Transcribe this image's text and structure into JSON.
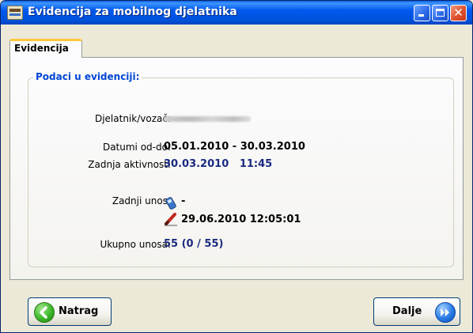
{
  "window": {
    "title": "Evidencija za mobilnog djelatnika"
  },
  "tab": {
    "label": "Evidencija"
  },
  "group": {
    "legend": "Podaci u evidenciji:"
  },
  "fields": {
    "employee_label": "Djelatnik/vozač:",
    "dates_label": "Datumi od-do:",
    "dates_value": "05.01.2010 - 30.03.2010",
    "last_activity_label": "Zadnja aktivnost:",
    "last_activity_value": "30.03.2010   11:45",
    "last_entry_label": "Zadnji unos:",
    "last_entry_mobile": "-",
    "last_entry_manual": "29.06.2010 12:05:01",
    "total_label": "Ukupno unosa:",
    "total_value": "55 (0 / 55)"
  },
  "buttons": {
    "back_label": "Natrag",
    "next_label": "Dalje"
  },
  "icons": {
    "app": "app-icon",
    "phone": "mobile-phone-icon",
    "pen": "pen-icon",
    "back": "back-arrow-icon",
    "next": "forward-arrow-icon"
  },
  "colors": {
    "titlebar": "#0054e3",
    "tab_highlight": "#ffc83c",
    "legend_text": "#0046d5",
    "value_navy": "#1a2a80"
  }
}
